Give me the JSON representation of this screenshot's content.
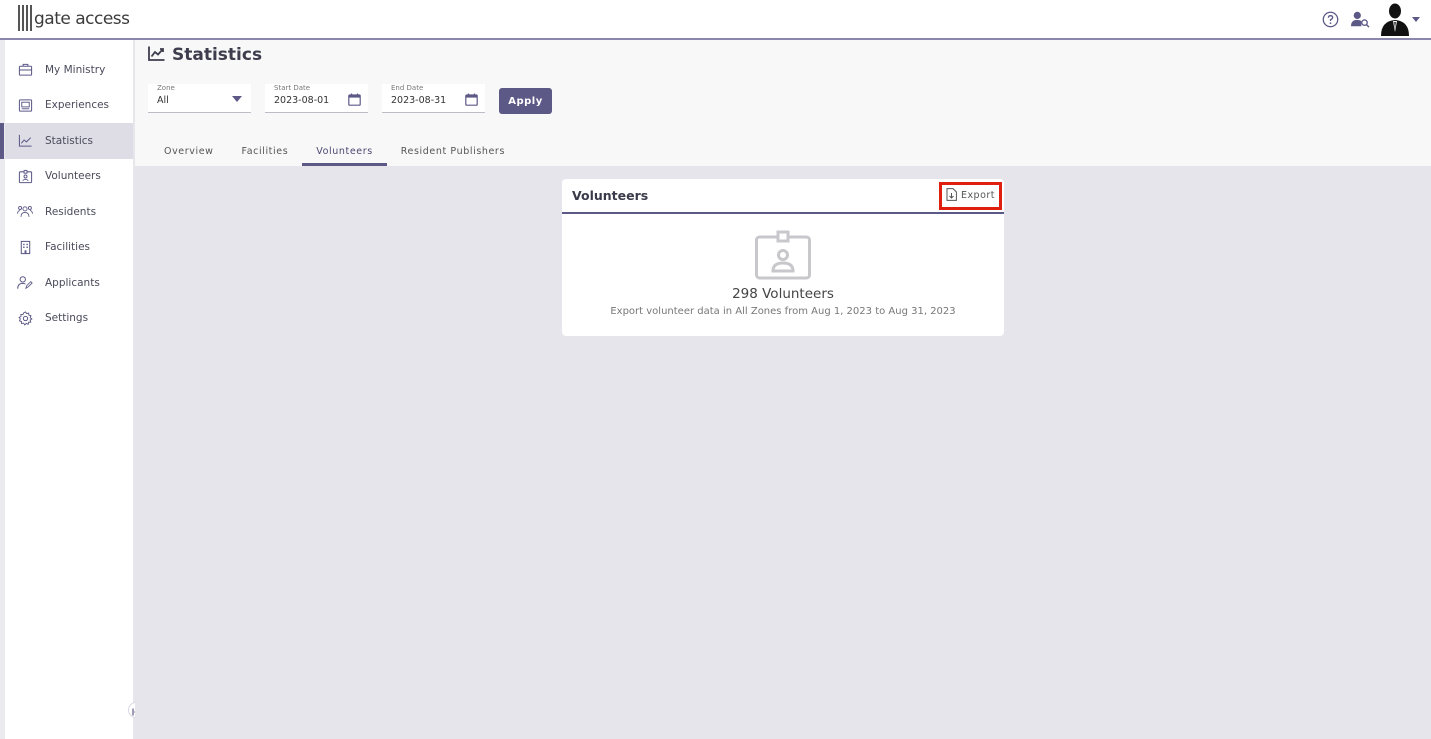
{
  "app": {
    "logo_text": "gate access"
  },
  "sidebar": {
    "items": [
      {
        "label": "My Ministry",
        "icon": "briefcase-icon"
      },
      {
        "label": "Experiences",
        "icon": "album-icon"
      },
      {
        "label": "Statistics",
        "icon": "chart-line-icon",
        "active": true
      },
      {
        "label": "Volunteers",
        "icon": "id-badge-icon"
      },
      {
        "label": "Residents",
        "icon": "people-icon"
      },
      {
        "label": "Facilities",
        "icon": "building-icon"
      },
      {
        "label": "Applicants",
        "icon": "user-edit-icon"
      },
      {
        "label": "Settings",
        "icon": "gear-icon"
      }
    ]
  },
  "page": {
    "title": "Statistics"
  },
  "filters": {
    "zone": {
      "label": "Zone",
      "value": "All"
    },
    "start_date": {
      "label": "Start Date",
      "value": "2023-08-01"
    },
    "end_date": {
      "label": "End Date",
      "value": "2023-08-31"
    },
    "apply_label": "Apply"
  },
  "tabs": [
    {
      "label": "Overview"
    },
    {
      "label": "Facilities"
    },
    {
      "label": "Volunteers",
      "active": true
    },
    {
      "label": "Resident Publishers"
    }
  ],
  "card": {
    "title": "Volunteers",
    "export_label": "Export",
    "count_text": "298 Volunteers",
    "description": "Export volunteer data in All Zones from Aug 1, 2023 to Aug 31, 2023"
  },
  "colors": {
    "accent": "#5c5987",
    "highlight": "#e0200e",
    "background": "#e6e5eb"
  }
}
